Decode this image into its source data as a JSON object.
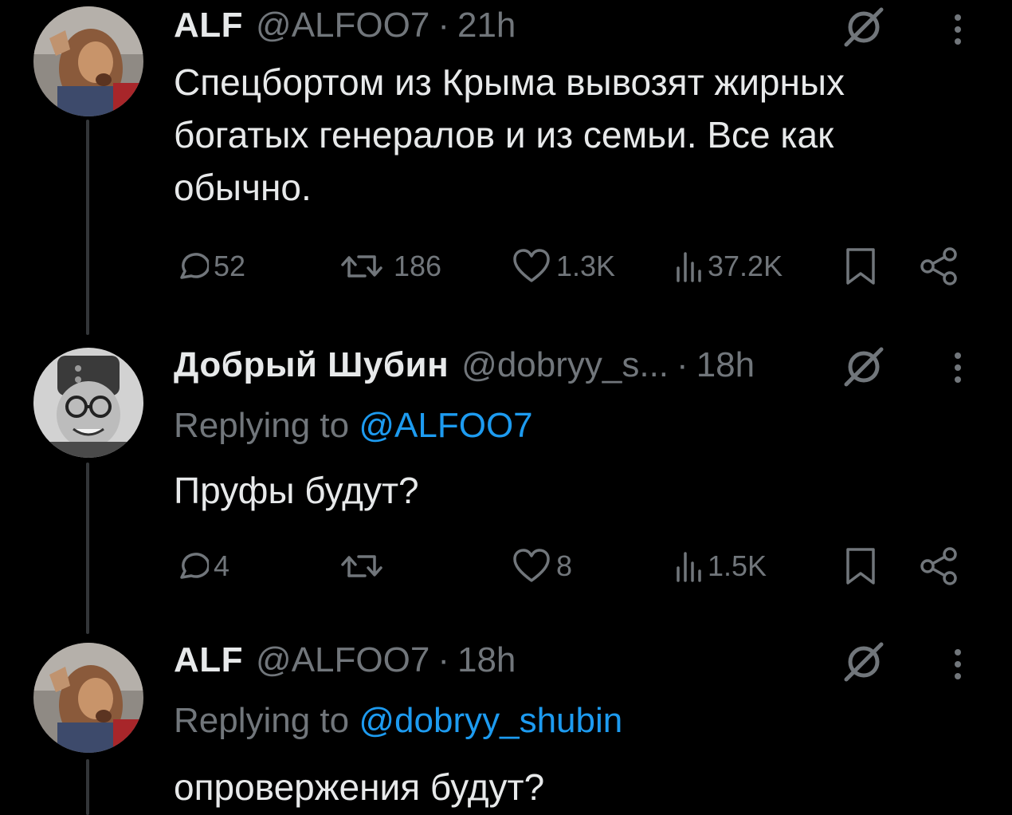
{
  "tweets": [
    {
      "name": "ALF",
      "handle": "@ALFOO7",
      "dot": "·",
      "time": "21h",
      "text": "Спецбортом из Крыма вывозят жирных богатых генералов и из семьи. Все как обычно.",
      "actions": {
        "replies": "52",
        "retweets": "186",
        "likes": "1.3K",
        "views": "37.2K"
      }
    },
    {
      "name": "Добрый Шубин",
      "handle": "@dobryy_s...",
      "dot": "·",
      "time": "18h",
      "replying_prefix": "Replying to",
      "replying_to": "@ALFOO7",
      "text": "Пруфы будут?",
      "actions": {
        "replies": "4",
        "retweets": "",
        "likes": "8",
        "views": "1.5K"
      }
    },
    {
      "name": "ALF",
      "handle": "@ALFOO7",
      "dot": "·",
      "time": "18h",
      "replying_prefix": "Replying to",
      "replying_to": "@dobryy_shubin",
      "text": "опровержения будут?"
    }
  ],
  "icons": {
    "reply": "reply-icon",
    "retweet": "retweet-icon",
    "like": "heart-icon",
    "views": "views-icon",
    "bookmark": "bookmark-icon",
    "share": "share-icon",
    "grok": "grok-icon",
    "more": "more-icon"
  },
  "colors": {
    "background": "#000000",
    "text": "#e7e9ea",
    "muted": "#71767b",
    "link": "#1d9bf0",
    "thread_line": "#333639"
  }
}
